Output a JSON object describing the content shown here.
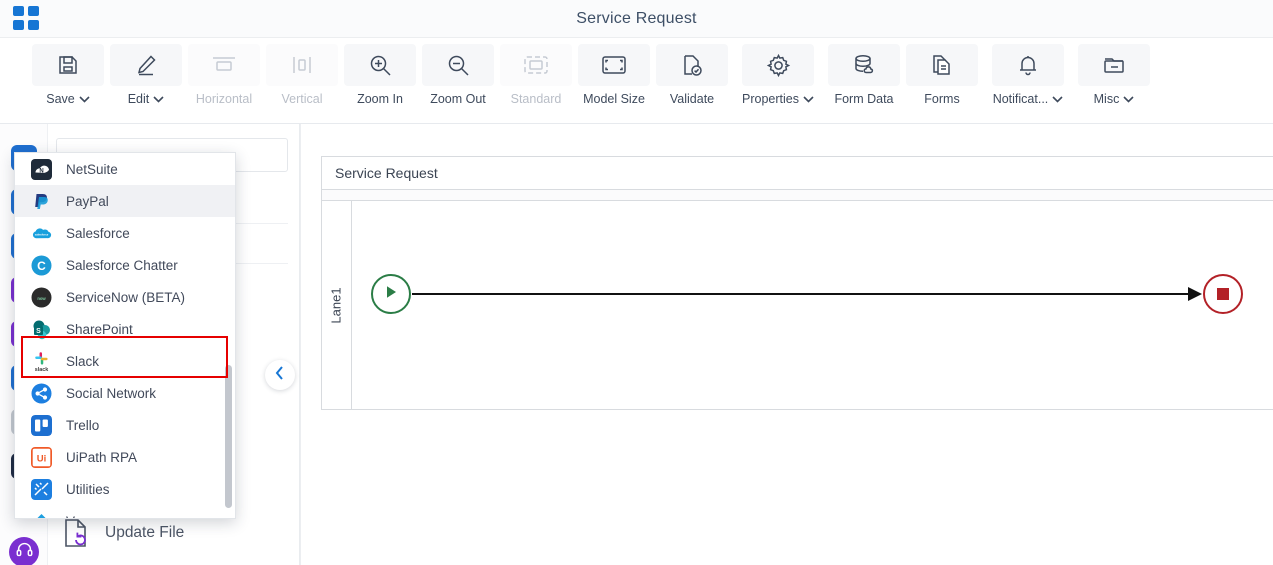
{
  "titlebar": {
    "app_icon": "grid-apps-icon",
    "title": "Service Request"
  },
  "toolbar": {
    "items": [
      {
        "label": "Save",
        "icon": "save-disk-icon",
        "caret": true,
        "disabled": false
      },
      {
        "label": "Edit",
        "icon": "pencil-edit-icon",
        "caret": true,
        "disabled": false
      },
      {
        "label": "Horizontal",
        "icon": "horizontal-align-icon",
        "caret": false,
        "disabled": true
      },
      {
        "label": "Vertical",
        "icon": "vertical-align-icon",
        "caret": false,
        "disabled": true
      },
      {
        "label": "Zoom In",
        "icon": "zoom-in-icon",
        "caret": false,
        "disabled": false
      },
      {
        "label": "Zoom Out",
        "icon": "zoom-out-icon",
        "caret": false,
        "disabled": false
      },
      {
        "label": "Standard",
        "icon": "standard-size-icon",
        "caret": false,
        "disabled": true
      },
      {
        "label": "Model Size",
        "icon": "model-size-icon",
        "caret": false,
        "disabled": false
      },
      {
        "label": "Validate",
        "icon": "validate-doc-icon",
        "caret": false,
        "disabled": false
      },
      {
        "label": "Properties",
        "icon": "gear-icon",
        "caret": true,
        "disabled": false
      },
      {
        "label": "Form Data",
        "icon": "database-cloud-icon",
        "caret": false,
        "disabled": false
      },
      {
        "label": "Forms",
        "icon": "document-copy-icon",
        "caret": false,
        "disabled": false
      },
      {
        "label": "Notificat...",
        "icon": "bell-icon",
        "caret": true,
        "disabled": false
      },
      {
        "label": "Misc",
        "icon": "folder-minus-icon",
        "caret": true,
        "disabled": false
      }
    ]
  },
  "left_rail": {
    "items": [
      {
        "name": "rail-icon-1",
        "color": "#1f6fd0"
      },
      {
        "name": "rail-icon-2",
        "color": "#1f6fd0"
      },
      {
        "name": "rail-icon-3",
        "color": "#1f6fd0"
      },
      {
        "name": "rail-icon-4",
        "color": "#7a2fd0"
      },
      {
        "name": "rail-icon-5",
        "color": "#7a2fd0"
      },
      {
        "name": "rail-icon-6",
        "color": "#1f6fd0"
      },
      {
        "name": "rail-icon-7",
        "color": "#9aa3ae"
      },
      {
        "name": "rail-icon-8",
        "color": "#1f2b44"
      }
    ]
  },
  "palette": {
    "search_placeholder": "",
    "update_file_label": "Update File",
    "collapse_icon": "chevron-left-icon",
    "support_icon": "headset-support-icon"
  },
  "dropdown": {
    "hovered_item": "PayPal",
    "highlighted_item": "Slack",
    "highlight_color": "#e60000",
    "items": [
      {
        "label": "NetSuite",
        "icon": "netsuite-icon",
        "icon_bg": "#1f2b3a",
        "icon_fg": "#ffffff",
        "glyph": "N"
      },
      {
        "label": "PayPal",
        "icon": "paypal-icon",
        "icon_bg": "#ffffff",
        "icon_fg": "#253b80",
        "glyph": "P"
      },
      {
        "label": "Salesforce",
        "icon": "salesforce-icon",
        "icon_bg": "#ffffff",
        "icon_fg": "#1fa0e0",
        "glyph": "☁"
      },
      {
        "label": "Salesforce Chatter",
        "icon": "salesforce-chatter-icon",
        "icon_bg": "#1c9ad6",
        "icon_fg": "#ffffff",
        "glyph": "C"
      },
      {
        "label": "ServiceNow (BETA)",
        "icon": "servicenow-icon",
        "icon_bg": "#2b2b2b",
        "icon_fg": "#ffffff",
        "glyph": "●"
      },
      {
        "label": "SharePoint",
        "icon": "sharepoint-icon",
        "icon_bg": "#1b7f6b",
        "icon_fg": "#ffffff",
        "glyph": "S"
      },
      {
        "label": "Slack",
        "icon": "slack-icon",
        "icon_bg": "#ffffff",
        "icon_fg": "#3a3a3a",
        "glyph": "✳"
      },
      {
        "label": "Social Network",
        "icon": "social-network-icon",
        "icon_bg": "#1d7fe0",
        "icon_fg": "#ffffff",
        "glyph": "⁂"
      },
      {
        "label": "Trello",
        "icon": "trello-icon",
        "icon_bg": "#1d6fd0",
        "icon_fg": "#ffffff",
        "glyph": "⬛"
      },
      {
        "label": "UiPath RPA",
        "icon": "uipath-rpa-icon",
        "icon_bg": "#ffffff",
        "icon_fg": "#f05a28",
        "glyph": "Ui"
      },
      {
        "label": "Utilities",
        "icon": "utilities-icon",
        "icon_bg": "#1d7fe0",
        "icon_fg": "#ffffff",
        "glyph": "⚙"
      },
      {
        "label": "V",
        "icon": "v-item-icon",
        "icon_bg": "#1d9fe0",
        "icon_fg": "#ffffff",
        "glyph": "V"
      }
    ]
  },
  "canvas": {
    "pool_name": "Service Request",
    "lane_name": "Lane1",
    "start_event": {
      "name": "start-event",
      "type": "message-start",
      "color": "#2b7d46"
    },
    "end_event": {
      "name": "end-event",
      "type": "terminate-end",
      "color": "#b32127"
    },
    "sequence_flow": {
      "name": "sequence-flow",
      "color": "#111111"
    }
  }
}
